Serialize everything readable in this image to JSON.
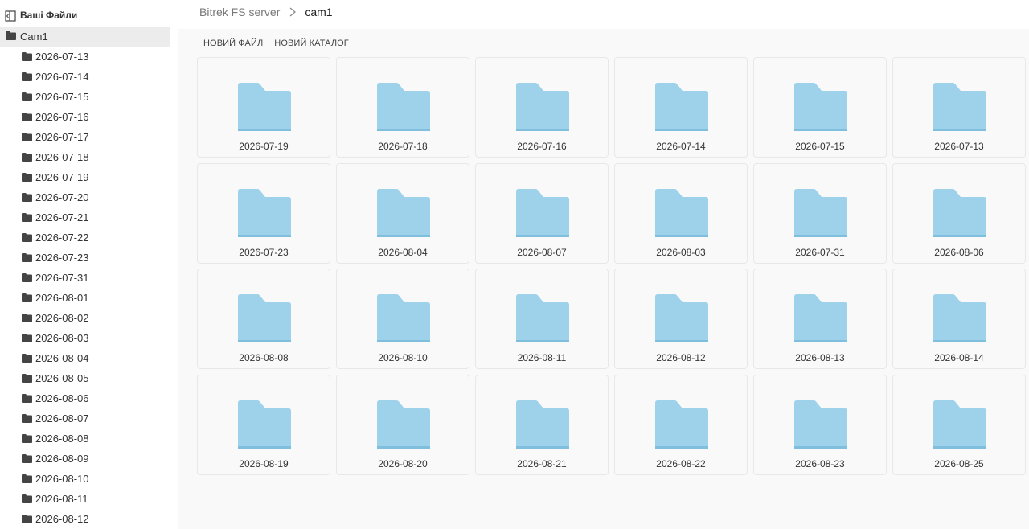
{
  "sidebar": {
    "header_label": "Ваші Файли",
    "root": {
      "label": "Cam1"
    },
    "items": [
      {
        "label": "2026-07-13"
      },
      {
        "label": "2026-07-14"
      },
      {
        "label": "2026-07-15"
      },
      {
        "label": "2026-07-16"
      },
      {
        "label": "2026-07-17"
      },
      {
        "label": "2026-07-18"
      },
      {
        "label": "2026-07-19"
      },
      {
        "label": "2026-07-20"
      },
      {
        "label": "2026-07-21"
      },
      {
        "label": "2026-07-22"
      },
      {
        "label": "2026-07-23"
      },
      {
        "label": "2026-07-31"
      },
      {
        "label": "2026-08-01"
      },
      {
        "label": "2026-08-02"
      },
      {
        "label": "2026-08-03"
      },
      {
        "label": "2026-08-04"
      },
      {
        "label": "2026-08-05"
      },
      {
        "label": "2026-08-06"
      },
      {
        "label": "2026-08-07"
      },
      {
        "label": "2026-08-08"
      },
      {
        "label": "2026-08-09"
      },
      {
        "label": "2026-08-10"
      },
      {
        "label": "2026-08-11"
      },
      {
        "label": "2026-08-12"
      }
    ]
  },
  "breadcrumb": {
    "root": "Bitrek FS server",
    "current": "cam1"
  },
  "toolbar": {
    "new_file": "НОВИЙ ФАЙЛ",
    "new_folder": "НОВИЙ КАТАЛОГ"
  },
  "folders": [
    {
      "label": "2026-07-19"
    },
    {
      "label": "2026-07-18"
    },
    {
      "label": "2026-07-16"
    },
    {
      "label": "2026-07-14"
    },
    {
      "label": "2026-07-15"
    },
    {
      "label": "2026-07-13"
    },
    {
      "label": "2026-07-23"
    },
    {
      "label": "2026-08-04"
    },
    {
      "label": "2026-08-07"
    },
    {
      "label": "2026-08-03"
    },
    {
      "label": "2026-07-31"
    },
    {
      "label": "2026-08-06"
    },
    {
      "label": "2026-08-08"
    },
    {
      "label": "2026-08-10"
    },
    {
      "label": "2026-08-11"
    },
    {
      "label": "2026-08-12"
    },
    {
      "label": "2026-08-13"
    },
    {
      "label": "2026-08-14"
    },
    {
      "label": "2026-08-19"
    },
    {
      "label": "2026-08-20"
    },
    {
      "label": "2026-08-21"
    },
    {
      "label": "2026-08-22"
    },
    {
      "label": "2026-08-23"
    },
    {
      "label": "2026-08-25"
    }
  ],
  "colors": {
    "folder_fill": "#9dd2ea",
    "folder_tab": "#9dd2ea",
    "folder_shadow": "#7fbedd",
    "sidebar_icon": "#444444",
    "selected_bg": "#ececec"
  },
  "icons": {
    "sidebar_header": "sidebar-toggle-icon",
    "tree_folder": "folder-icon",
    "breadcrumb_separator": "chevron-right-icon",
    "tile_folder": "folder-icon"
  }
}
